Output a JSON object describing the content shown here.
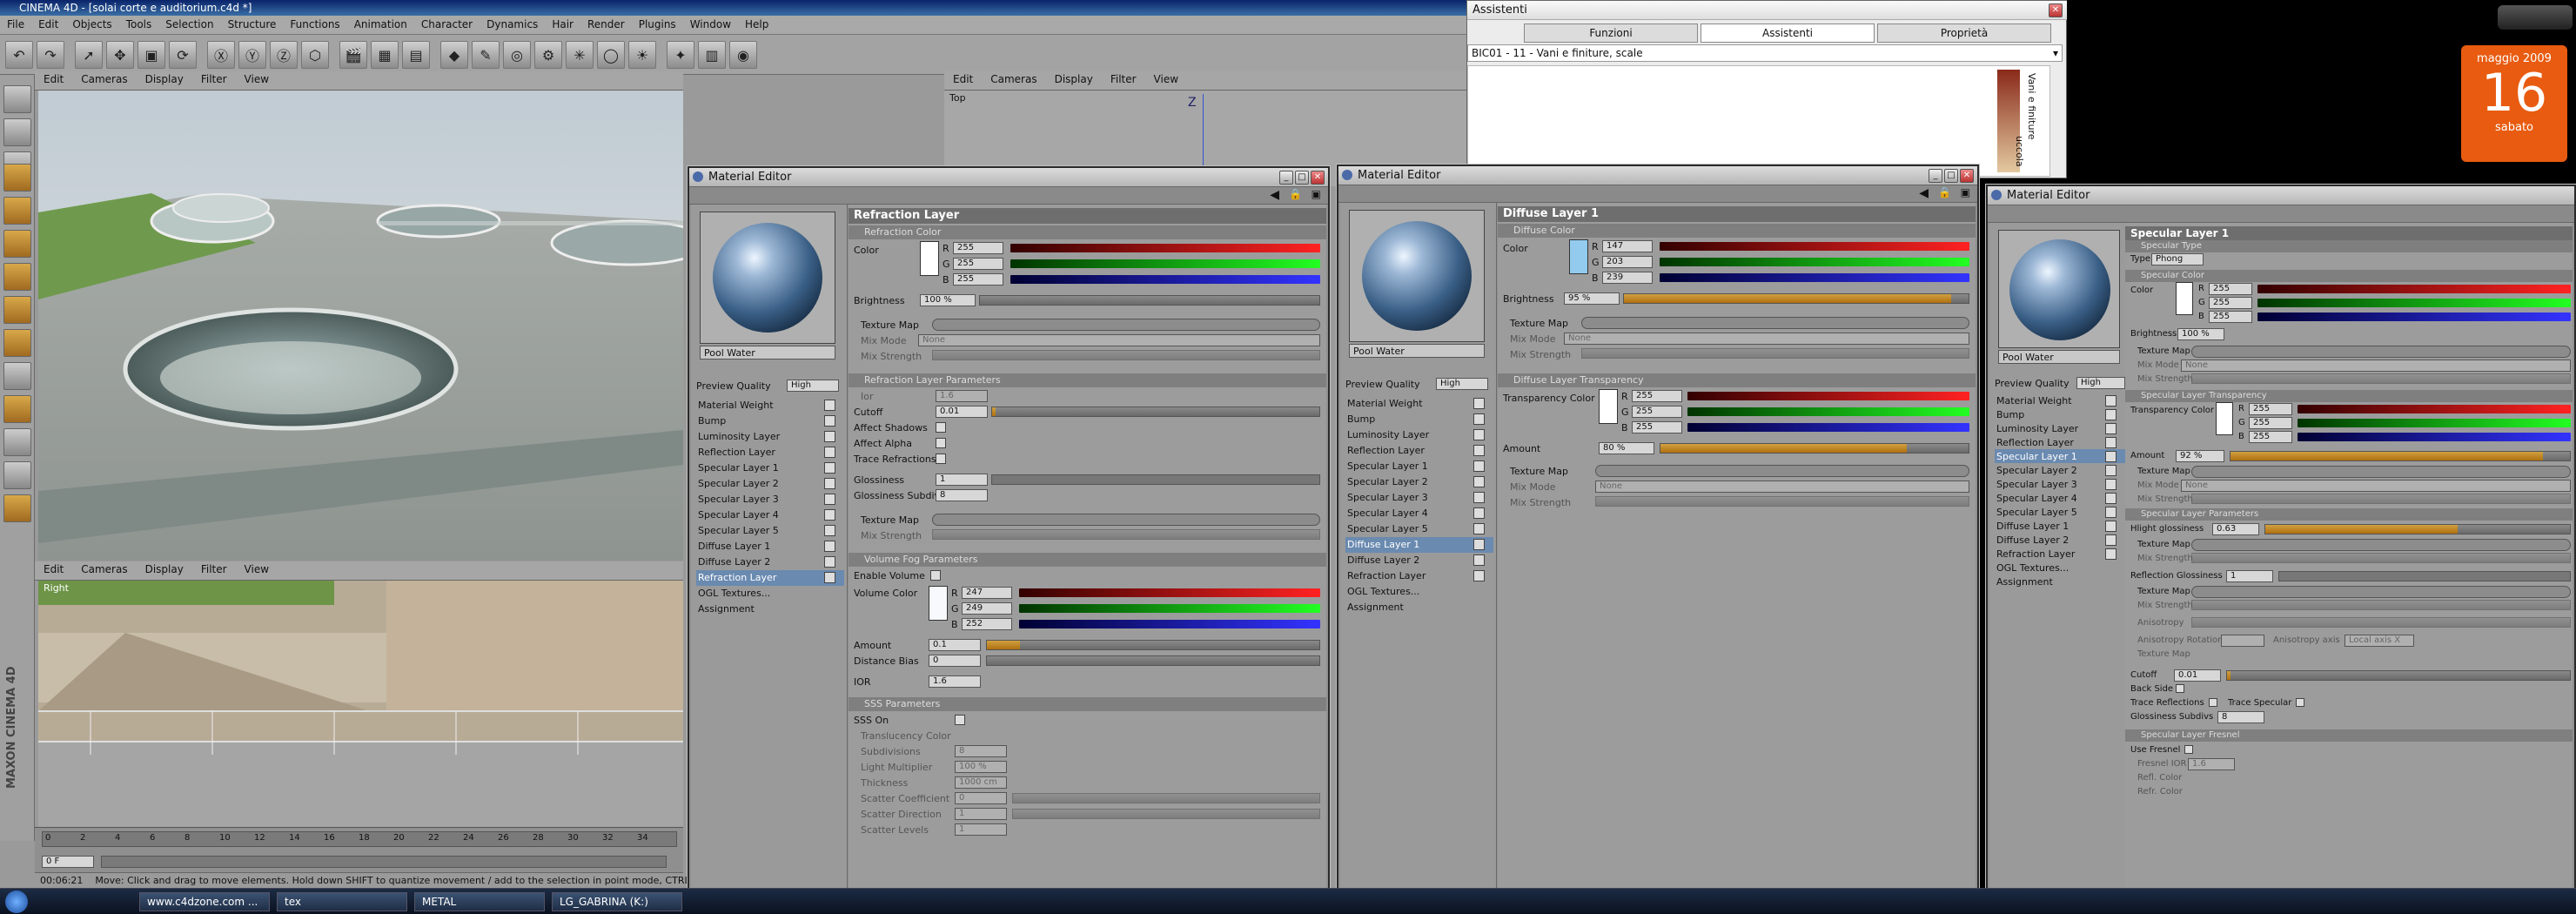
{
  "app": {
    "title": "CINEMA 4D - [solai corte e auditorium.c4d *]",
    "menu": [
      "File",
      "Edit",
      "Objects",
      "Tools",
      "Selection",
      "Structure",
      "Functions",
      "Animation",
      "Character",
      "Dynamics",
      "Hair",
      "Render",
      "Plugins",
      "Window",
      "Help"
    ],
    "viewport_menu": [
      "Edit",
      "Cameras",
      "Display",
      "Filter",
      "View"
    ],
    "top_label": "Top",
    "right_label": "Right",
    "axis_z": "Z",
    "timeline_ticks": [
      "0",
      "2",
      "4",
      "6",
      "8",
      "10",
      "12",
      "14",
      "16",
      "18",
      "20",
      "22",
      "24",
      "26",
      "28",
      "30",
      "32",
      "34"
    ],
    "frame_field": "0 F",
    "status_time": "00:06:21",
    "status_text": "Move: Click and drag to move elements. Hold down SHIFT to quantize movement / add to the selection in point mode, CTRL to remove.",
    "maxon_logo": "MAXON CINEMA 4D"
  },
  "assistant": {
    "title": "Assistenti",
    "tabs": [
      "Funzioni",
      "Assistenti",
      "Proprietà"
    ],
    "combo": "BIC01 - 11 - Vani e finiture, scale",
    "side_text": "Vani e finiture",
    "side_text2": "uccola"
  },
  "calendar": {
    "month": "maggio 2009",
    "day": "16",
    "weekday": "sabato"
  },
  "taskbar": [
    "www.c4dzone.com ...",
    "tex",
    "METAL",
    "LG_GABRINA (K:)"
  ],
  "channels": [
    "Material Weight",
    "Bump",
    "Luminosity Layer",
    "Reflection Layer",
    "Specular Layer 1",
    "Specular Layer 2",
    "Specular Layer 3",
    "Specular Layer 4",
    "Specular Layer 5",
    "Diffuse Layer 1",
    "Diffuse Layer 2",
    "Refraction Layer"
  ],
  "extra_items": [
    "OGL Textures...",
    "Assignment"
  ],
  "editor_common": {
    "title": "Material Editor",
    "mat_name": "Pool Water",
    "preview_quality": "Preview Quality",
    "quality_value": "High"
  },
  "ed1": {
    "layer": "Refraction Layer",
    "sec_color": "Refraction Color",
    "color_label": "Color",
    "r": "255",
    "g": "255",
    "b": "255",
    "brightness_label": "Brightness",
    "brightness": "100 %",
    "texmap": "Texture Map",
    "mixmode": "Mix Mode",
    "mixmode_val": "None",
    "mixstrength": "Mix Strength",
    "sec_params": "Refraction Layer Parameters",
    "ior_label": "Ior",
    "ior_val": "1.6",
    "cutoff_label": "Cutoff",
    "cutoff": "0.01",
    "affect_shadows": "Affect Shadows",
    "affect_alpha": "Affect Alpha",
    "trace_refr": "Trace Refractions",
    "glossiness": "Glossiness",
    "gloss_val": "1",
    "gloss_subdivs": "Glossiness Subdivs",
    "gloss_subdivs_val": "8",
    "sec_fog": "Volume Fog Parameters",
    "enable_volume": "Enable Volume",
    "volume_color": "Volume Color",
    "vr": "247",
    "vg": "249",
    "vb": "252",
    "amount": "Amount",
    "amount_val": "0.1",
    "distance_bias": "Distance Bias",
    "distance_bias_val": "0",
    "ior": "IOR",
    "ior2": "1.6",
    "sec_sss": "SSS Parameters",
    "sss_on": "SSS On",
    "transl_color": "Translucency Color",
    "subdivisions": "Subdivisions",
    "subdiv_val": "8",
    "light_mult": "Light Multiplier",
    "light_mult_val": "100 %",
    "thickness": "Thickness",
    "thickness_val": "1000 cm",
    "scatter_coeff": "Scatter Coefficient",
    "scatter_coeff_val": "0",
    "scatter_dir": "Scatter Direction",
    "scatter_dir_val": "1",
    "scatter_levels": "Scatter Levels",
    "scatter_levels_val": "1"
  },
  "ed2": {
    "layer": "Diffuse Layer 1",
    "sec_color": "Diffuse Color",
    "color_label": "Color",
    "r": "147",
    "g": "203",
    "b": "239",
    "brightness_label": "Brightness",
    "brightness": "95 %",
    "texmap": "Texture Map",
    "mixmode": "Mix Mode",
    "mixmode_val": "None",
    "mixstrength": "Mix Strength",
    "sec_transp": "Diffuse Layer Transparency",
    "transp_color": "Transparency Color",
    "tr": "255",
    "tg": "255",
    "tb": "255",
    "amount": "Amount",
    "amount_val": "80 %"
  },
  "ed3": {
    "layer": "Specular Layer 1",
    "sec_type": "Specular Type",
    "type_label": "Type",
    "type_val": "Phong",
    "sec_color": "Specular Color",
    "color_label": "Color",
    "r": "255",
    "g": "255",
    "b": "255",
    "brightness_label": "Brightness",
    "brightness": "100 %",
    "texmap": "Texture Map",
    "mixmode": "Mix Mode",
    "mixmode_val": "None",
    "mixstrength": "Mix Strength",
    "sec_transp": "Specular Layer Transparency",
    "transp_color": "Transparency Color",
    "tr": "255",
    "tg": "255",
    "tb": "255",
    "amount": "Amount",
    "amount_val": "92 %",
    "sec_params": "Specular Layer Parameters",
    "hlight_gloss": "Hlight glossiness",
    "hlight_gloss_val": "0.63",
    "refl_gloss": "Reflection Glossiness",
    "refl_gloss_val": "1",
    "anisotropy": "Anisotropy",
    "aniso_rot": "Anisotropy Rotation",
    "aniso_axis": "Anisotropy axis",
    "aniso_axis_val": "Local axis X",
    "cutoff": "Cutoff",
    "cutoff_val": "0.01",
    "back_side": "Back Side",
    "trace_refl": "Trace Reflections",
    "trace_spec": "Trace Specular",
    "gloss_subdivs": "Glossiness Subdivs",
    "gloss_subdivs_val": "8",
    "sec_fresnel": "Specular Layer Fresnel",
    "use_fresnel": "Use Fresnel",
    "fresnel_ior": "Fresnel IOR",
    "fresnel_ior_val": "1.6",
    "refl_color": "Refl. Color",
    "refr_color": "Refr. Color"
  }
}
